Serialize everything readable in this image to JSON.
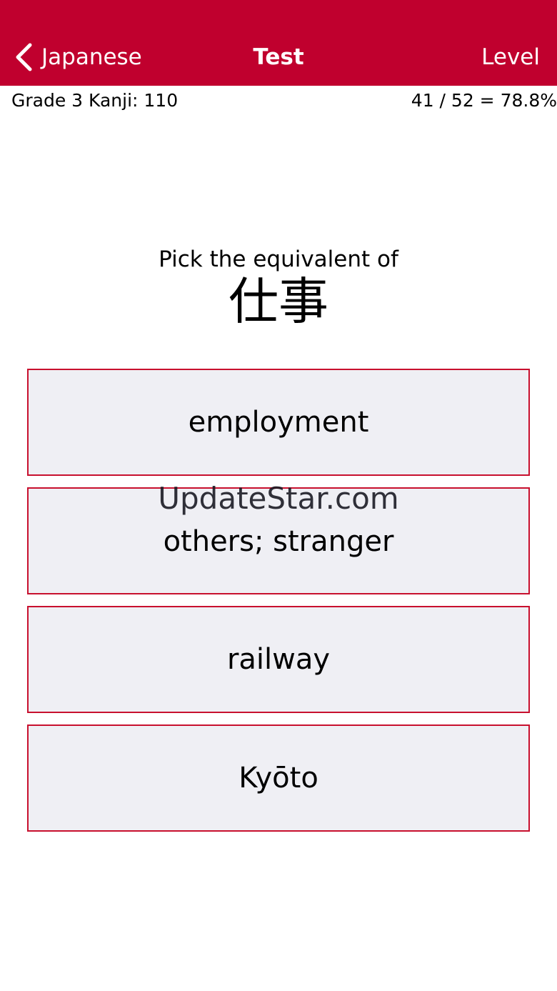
{
  "navbar": {
    "back_label": "Japanese",
    "title": "Test",
    "right_label": "Level",
    "background_color": "#c0002e",
    "text_color": "#ffffff"
  },
  "info": {
    "left": "Grade 3 Kanji: 110",
    "right": "41 / 52 = 78.8%"
  },
  "question": {
    "prompt": "Pick the equivalent of",
    "term": "仕事"
  },
  "options": [
    {
      "label": "employment"
    },
    {
      "label": "others; stranger"
    },
    {
      "label": "railway"
    },
    {
      "label": "Kyōto"
    }
  ],
  "option_style": {
    "border_color": "#c8102e",
    "background_color": "#efeff4"
  },
  "watermark": {
    "text": "UpdateStar.com"
  }
}
